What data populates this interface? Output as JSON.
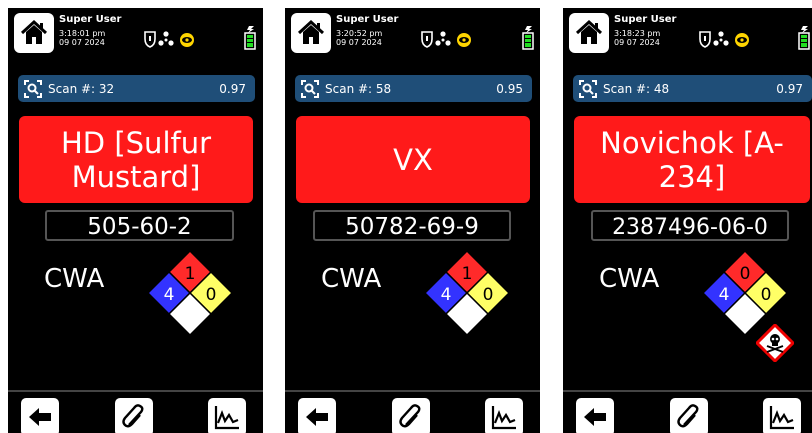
{
  "screens": [
    {
      "user": "Super User",
      "time": "3:18:01 pm",
      "date": "09 07 2024",
      "scan_label": "Scan #: 32",
      "score": "0.97",
      "chemical": "HD [Sulfur Mustard]",
      "cas": "505-60-2",
      "class": "CWA",
      "nfpa": {
        "health": "4",
        "flammability": "1",
        "instability": "0"
      }
    },
    {
      "user": "Super User",
      "time": "3:20:52 pm",
      "date": "09 07 2024",
      "scan_label": "Scan #: 58",
      "score": "0.95",
      "chemical": "VX",
      "cas": "50782-69-9",
      "class": "CWA",
      "nfpa": {
        "health": "4",
        "flammability": "1",
        "instability": "0"
      }
    },
    {
      "user": "Super User",
      "time": "3:18:23 pm",
      "date": "09 07 2024",
      "scan_label": "Scan #: 48",
      "score": "0.97",
      "chemical": "Novichok [A-234]",
      "cas": "2387496-06-0",
      "class": "CWA",
      "nfpa": {
        "health": "4",
        "flammability": "0",
        "instability": "0"
      }
    }
  ],
  "colors": {
    "screen_bg": "#000000",
    "alert_red": "#ff1a1a",
    "scan_bar_blue": "#1f4e78",
    "nfpa_health_blue": "#3333ff",
    "nfpa_flammability_red": "#ff2a2a",
    "nfpa_instability_yellow": "#ffff66",
    "nfpa_special_white": "#ffffff",
    "battery_green": "#22dd22"
  },
  "icons": [
    "home-icon",
    "shield-icon",
    "radiation-icon",
    "eye-icon",
    "battery-icon",
    "charging-icon",
    "scan-icon",
    "skull-crossbones-icon",
    "back-arrow-icon",
    "paperclip-icon",
    "spectrum-chart-icon"
  ]
}
